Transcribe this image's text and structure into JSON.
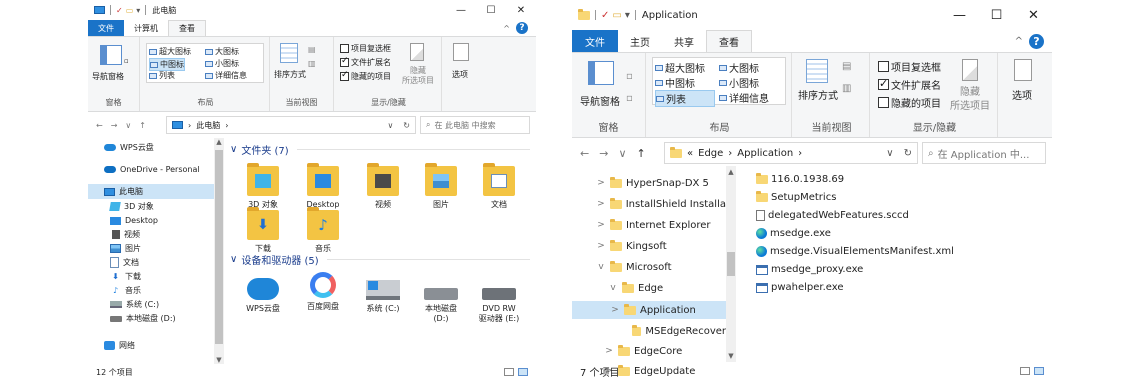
{
  "left_window": {
    "title": "此电脑",
    "ribbon_tabs": [
      "文件",
      "计算机",
      "查看"
    ],
    "ribbon": {
      "pane_group": {
        "nav_pane": "导航窗格",
        "label": "窗格"
      },
      "layout_group": {
        "label": "布局",
        "items": [
          "超大图标",
          "大图标",
          "中图标",
          "小图标",
          "列表",
          "详细信息"
        ],
        "selected": "中图标"
      },
      "view_group": {
        "sort_by": "排序方式",
        "label": "当前视图"
      },
      "show_hide_group": {
        "item_checkboxes": "项目复选框",
        "file_extensions": "文件扩展名",
        "hidden_items": "隐藏的项目",
        "hide_selected": "隐藏",
        "hide_selected_2": "所选项目",
        "label": "显示/隐藏"
      },
      "options": "选项"
    },
    "address": {
      "path": "此电脑",
      "search_placeholder": "在 此电脑 中搜索"
    },
    "nav_items": [
      "WPS云盘",
      "OneDrive - Personal",
      "此电脑",
      "3D 对象",
      "Desktop",
      "视频",
      "图片",
      "文档",
      "下载",
      "音乐",
      "系统 (C:)",
      "本地磁盘 (D:)",
      "网络"
    ],
    "folders_header": "文件夹 (7)",
    "folders": [
      "3D 对象",
      "Desktop",
      "视频",
      "图片",
      "文档",
      "下载",
      "音乐"
    ],
    "devices_header": "设备和驱动器 (5)",
    "devices": [
      {
        "name": "WPS云盘",
        "name2": ""
      },
      {
        "name": "百度网盘",
        "name2": ""
      },
      {
        "name": "系统 (C:)",
        "name2": ""
      },
      {
        "name": "本地磁盘",
        "name2": "(D:)"
      },
      {
        "name": "DVD RW",
        "name2": "驱动器 (E:)"
      }
    ],
    "status": "12 个项目"
  },
  "right_window": {
    "title": "Application",
    "ribbon_tabs": [
      "文件",
      "主页",
      "共享",
      "查看"
    ],
    "ribbon": {
      "pane_group": {
        "nav_pane": "导航窗格",
        "label": "窗格"
      },
      "layout_group": {
        "label": "布局",
        "items": [
          "超大图标",
          "大图标",
          "中图标",
          "小图标",
          "列表",
          "详细信息"
        ],
        "selected": "列表"
      },
      "view_group": {
        "sort_by": "排序方式",
        "label": "当前视图"
      },
      "show_hide_group": {
        "item_checkboxes": "项目复选框",
        "file_extensions": "文件扩展名",
        "hidden_items": "隐藏的项目",
        "hide_selected": "隐藏",
        "hide_selected_2": "所选项目",
        "label": "显示/隐藏"
      },
      "options": "选项"
    },
    "address": {
      "prefix": "«",
      "seg1": "Edge",
      "seg2": "Application",
      "search_placeholder": "在 Application 中..."
    },
    "nav_items": [
      {
        "label": "HyperSnap-DX 5",
        "chev": ">"
      },
      {
        "label": "InstallShield Installa",
        "chev": ">"
      },
      {
        "label": "Internet Explorer",
        "chev": ">"
      },
      {
        "label": "Kingsoft",
        "chev": ">"
      },
      {
        "label": "Microsoft",
        "chev": "v"
      },
      {
        "label": "Edge",
        "chev": "v"
      },
      {
        "label": "Application",
        "chev": ">"
      },
      {
        "label": "MSEdgeRecover",
        "chev": ""
      },
      {
        "label": "EdgeCore",
        "chev": ">"
      },
      {
        "label": "EdgeUpdate",
        "chev": ">"
      }
    ],
    "files": [
      {
        "name": "116.0.1938.69",
        "icon": "folder"
      },
      {
        "name": "SetupMetrics",
        "icon": "folder"
      },
      {
        "name": "delegatedWebFeatures.sccd",
        "icon": "file"
      },
      {
        "name": "msedge.exe",
        "icon": "edge"
      },
      {
        "name": "msedge.VisualElementsManifest.xml",
        "icon": "edge"
      },
      {
        "name": "msedge_proxy.exe",
        "icon": "exe"
      },
      {
        "name": "pwahelper.exe",
        "icon": "exe"
      }
    ],
    "status": "7 个项目"
  },
  "icons": {
    "window_minimize": "minimize-icon",
    "window_maximize": "maximize-icon",
    "window_close": "close-icon",
    "help": "help-icon"
  },
  "colors": {
    "file_tab": "#1a73c8",
    "selection": "#cce4f7",
    "folder": "#f3c443"
  }
}
